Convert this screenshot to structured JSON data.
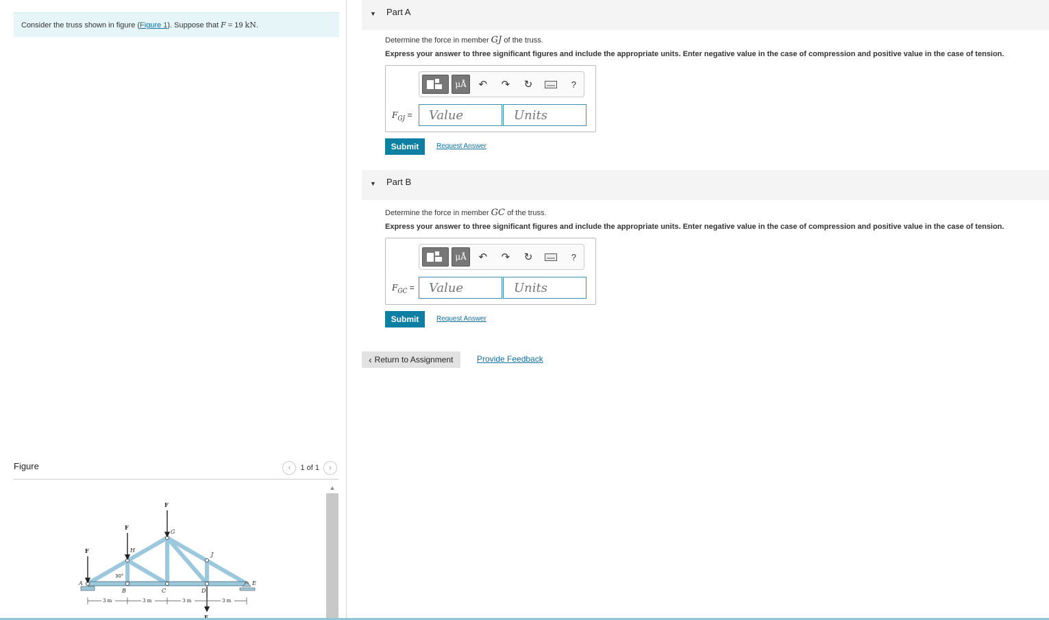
{
  "intro": {
    "text_before": "Consider the truss shown in figure (",
    "link": "Figure 1",
    "text_mid": "). Suppose that ",
    "var": "F",
    "text_eq": " = 19 ",
    "unit": "kN",
    "text_end": "."
  },
  "figure": {
    "title": "Figure",
    "pager": "1 of 1",
    "prev_icon": "chevron-left-icon",
    "next_icon": "chevron-right-icon",
    "labels": {
      "F": "F",
      "G": "G",
      "H": "H",
      "J": "J",
      "A": "A",
      "B": "B",
      "C": "C",
      "D": "D",
      "E": "E",
      "angle": "30°",
      "dim": "3 m"
    }
  },
  "partA": {
    "title": "Part A",
    "q_before": "Determine the force in member ",
    "member": "GJ",
    "q_after": " of the truss.",
    "instruction": "Express your answer to three significant figures and include the appropriate units. Enter negative value in the case of compression and positive value in the case of tension.",
    "label_var": "F",
    "label_sub": "GJ",
    "label_eq": " =",
    "value_placeholder": "Value",
    "units_placeholder": "Units",
    "submit": "Submit",
    "request": "Request Answer"
  },
  "partB": {
    "title": "Part B",
    "q_before": "Determine the force in member ",
    "member": "GC",
    "q_after": " of the truss.",
    "instruction": "Express your answer to three significant figures and include the appropriate units. Enter negative value in the case of compression and positive value in the case of tension.",
    "label_var": "F",
    "label_sub": "GC",
    "label_eq": " =",
    "value_placeholder": "Value",
    "units_placeholder": "Units",
    "submit": "Submit",
    "request": "Request Answer"
  },
  "toolbar": {
    "mu_label": "μÅ",
    "help": "?",
    "icons": [
      "templates-icon",
      "symbols-icon",
      "undo-icon",
      "redo-icon",
      "reset-icon",
      "keyboard-icon",
      "help-icon"
    ]
  },
  "footer": {
    "return": "Return to Assignment",
    "feedback": "Provide Feedback"
  }
}
